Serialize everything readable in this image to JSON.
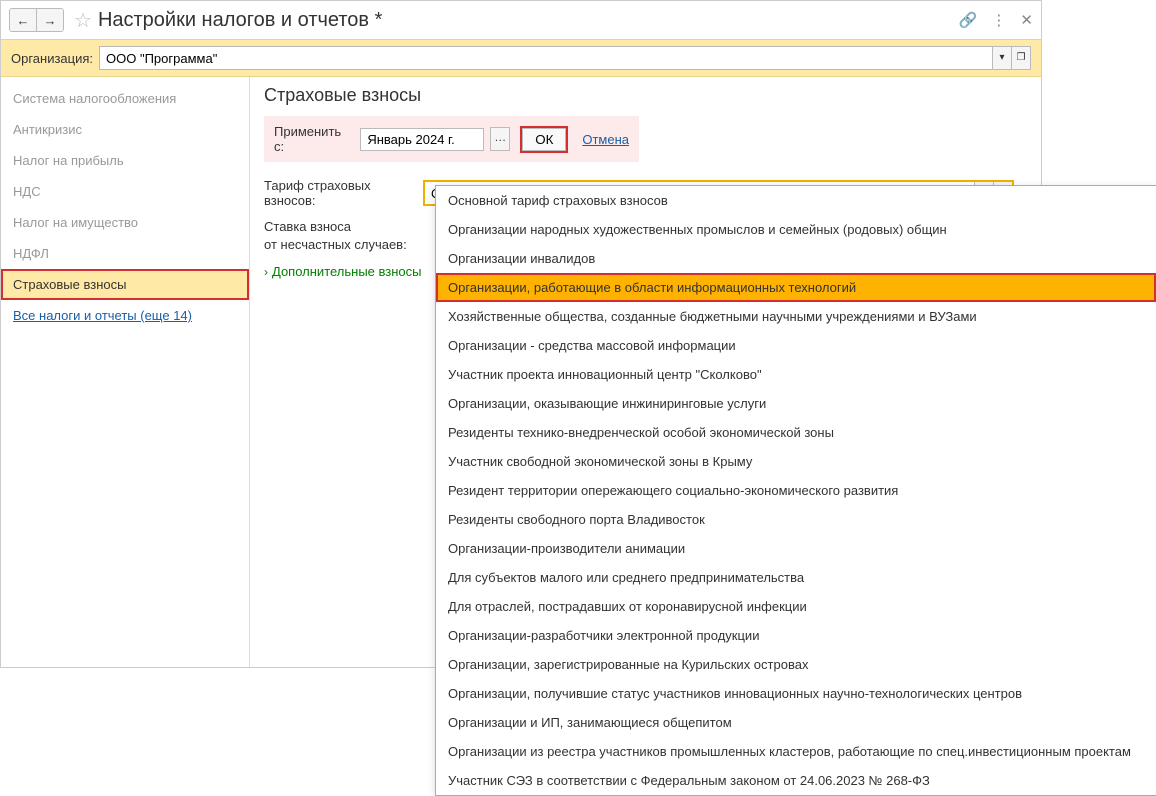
{
  "titlebar": {
    "title": "Настройки налогов и отчетов *"
  },
  "org": {
    "label": "Организация:",
    "value": "ООО \"Программа\""
  },
  "sidebar": {
    "items": [
      {
        "label": "Система налогообложения"
      },
      {
        "label": "Антикризис"
      },
      {
        "label": "Налог на прибыль"
      },
      {
        "label": "НДС"
      },
      {
        "label": "Налог на имущество"
      },
      {
        "label": "НДФЛ"
      },
      {
        "label": "Страховые взносы"
      },
      {
        "label": "Все налоги и отчеты (еще 14)"
      }
    ]
  },
  "content": {
    "section_title": "Страховые взносы",
    "apply": {
      "label": "Применить с:",
      "value": "Январь 2024 г.",
      "ok": "ОК",
      "cancel": "Отмена"
    },
    "tariff": {
      "label": "Тариф страховых взносов:",
      "value": "Организации, работающие в области информационных технологий"
    },
    "rate": {
      "label_line1": "Ставка взноса",
      "label_line2": "от несчастных случаев:"
    },
    "expand": "Дополнительные взносы"
  },
  "dropdown": {
    "items": [
      "Основной тариф страховых взносов",
      "Организации народных художественных промыслов и семейных (родовых) общин",
      "Организации инвалидов",
      "Организации, работающие в области информационных технологий",
      "Хозяйственные общества, созданные бюджетными научными учреждениями и ВУЗами",
      "Организации - средства массовой информации",
      "Участник проекта инновационный центр \"Сколково\"",
      "Организации, оказывающие инжиниринговые услуги",
      "Резиденты технико-внедренческой особой экономической зоны",
      "Участник свободной экономической зоны в Крыму",
      "Резидент территории опережающего социально-экономического развития",
      "Резиденты свободного порта Владивосток",
      "Организации-производители анимации",
      "Для субъектов малого или среднего предпринимательства",
      "Для отраслей, пострадавших от коронавирусной инфекции",
      "Организации-разработчики электронной продукции",
      "Организации, зарегистрированные на Курильских островах",
      "Организации, получившие статус участников инновационных научно-технологических центров",
      "Организации и ИП, занимающиеся общепитом",
      "Организации из реестра участников промышленных кластеров, работающие по спец.инвестиционным проектам",
      "Участник СЭЗ в соответствии с Федеральным законом от 24.06.2023 № 268-ФЗ"
    ],
    "selected_index": 3
  }
}
